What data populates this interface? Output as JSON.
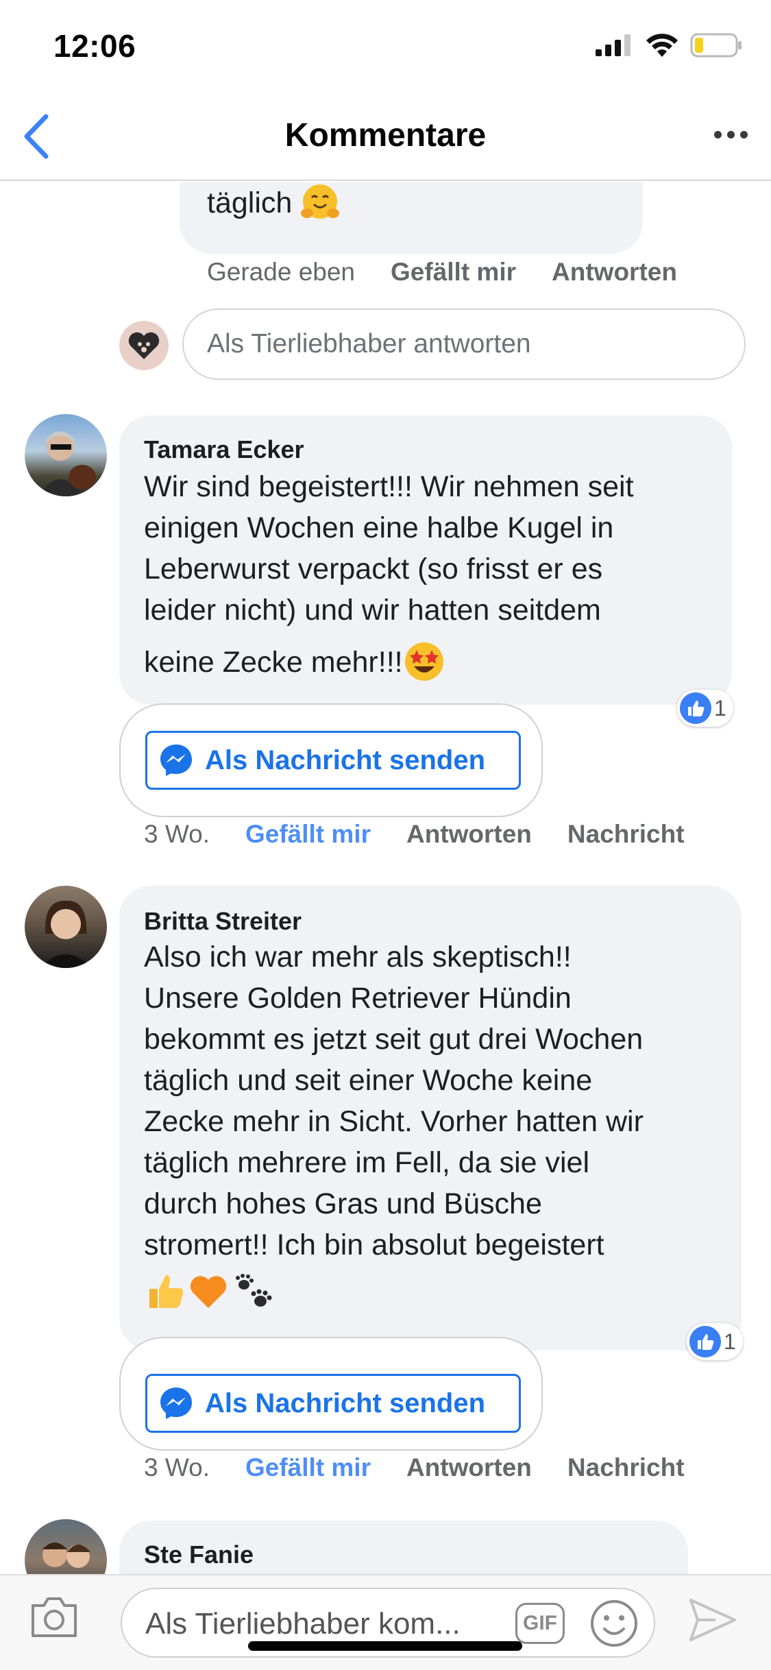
{
  "status_bar": {
    "time": "12:06"
  },
  "nav": {
    "title": "Kommentare"
  },
  "previous_reply": {
    "text_tail": "täglich",
    "emoji": "hug",
    "time": "Gerade eben",
    "like_label": "Gefällt mir",
    "reply_label": "Antworten"
  },
  "reply_input": {
    "placeholder": "Als Tierliebhaber antworten"
  },
  "comments": [
    {
      "author": "Tamara Ecker",
      "lines": [
        "Wir sind begeistert!!! Wir nehmen seit",
        "einigen Wochen eine halbe Kugel in",
        "Leberwurst verpackt (so frisst er es",
        "leider nicht) und wir hatten seitdem",
        "keine Zecke mehr!!!"
      ],
      "like_count": "1",
      "send_message_label": "Als Nachricht senden",
      "time": "3 Wo.",
      "like_label": "Gefällt mir",
      "reply_label": "Antworten",
      "message_label": "Nachricht"
    },
    {
      "author": "Britta Streiter",
      "lines": [
        "Also ich war mehr als skeptisch!!",
        "Unsere Golden Retriever Hündin",
        "bekommt es jetzt seit gut drei Wochen",
        "täglich und seit einer Woche keine",
        "Zecke mehr in Sicht. Vorher hatten wir",
        "täglich mehrere im Fell, da sie viel",
        "durch hohes Gras und Büsche",
        "stromert!! Ich bin absolut begeistert"
      ],
      "like_count": "1",
      "send_message_label": "Als Nachricht senden",
      "time": "3 Wo.",
      "like_label": "Gefällt mir",
      "reply_label": "Antworten",
      "message_label": "Nachricht"
    },
    {
      "author": "Ste Fanie"
    }
  ],
  "composer": {
    "placeholder": "Als Tierliebhaber kom...",
    "gif_label": "GIF"
  },
  "colors": {
    "accent": "#1a73e8",
    "liked": "#4e8ef6",
    "bubble": "#f0f2f5"
  }
}
